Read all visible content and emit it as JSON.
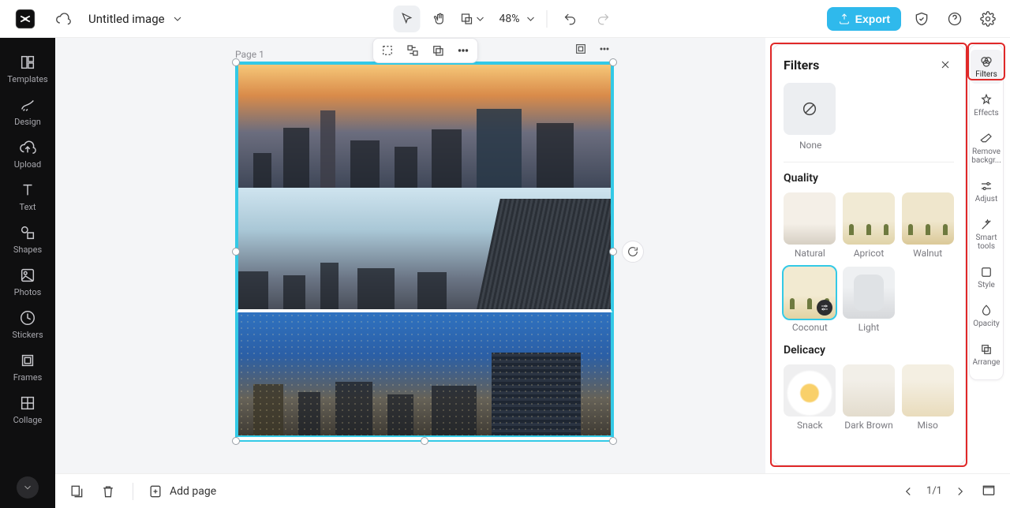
{
  "header": {
    "title": "Untitled image",
    "zoom_label": "48%",
    "export_label": "Export"
  },
  "left_sidebar": [
    {
      "key": "templates",
      "label": "Templates"
    },
    {
      "key": "design",
      "label": "Design"
    },
    {
      "key": "upload",
      "label": "Upload"
    },
    {
      "key": "text",
      "label": "Text"
    },
    {
      "key": "shapes",
      "label": "Shapes"
    },
    {
      "key": "photos",
      "label": "Photos"
    },
    {
      "key": "stickers",
      "label": "Stickers"
    },
    {
      "key": "frames",
      "label": "Frames"
    },
    {
      "key": "collage",
      "label": "Collage"
    }
  ],
  "canvas": {
    "page_label": "Page 1"
  },
  "filters_panel": {
    "title": "Filters",
    "none_label": "None",
    "sections": {
      "quality": {
        "title": "Quality",
        "items": [
          "Natural",
          "Apricot",
          "Walnut",
          "Coconut",
          "Light"
        ],
        "selected": "Coconut"
      },
      "delicacy": {
        "title": "Delicacy",
        "items": [
          "Snack",
          "Dark Brown",
          "Miso"
        ]
      }
    }
  },
  "props_sidebar": [
    {
      "key": "filters",
      "label": "Filters"
    },
    {
      "key": "effects",
      "label": "Effects"
    },
    {
      "key": "removebg",
      "label": "Remove backgr..."
    },
    {
      "key": "adjust",
      "label": "Adjust"
    },
    {
      "key": "smarttools",
      "label": "Smart tools"
    },
    {
      "key": "style",
      "label": "Style"
    },
    {
      "key": "opacity",
      "label": "Opacity"
    },
    {
      "key": "arrange",
      "label": "Arrange"
    }
  ],
  "bottombar": {
    "add_page_label": "Add page",
    "page_indicator": "1/1"
  }
}
